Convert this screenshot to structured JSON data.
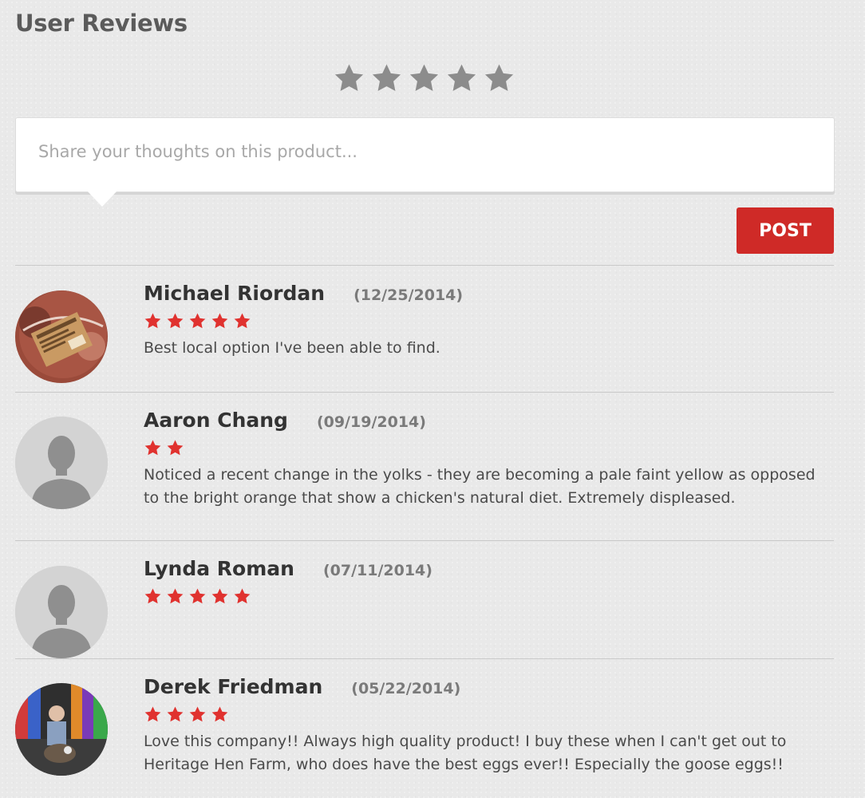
{
  "header": {
    "title": "User Reviews"
  },
  "rating_input": {
    "stars": 5,
    "selected": 0,
    "empty_color": "#8c8c8c"
  },
  "composer": {
    "placeholder": "Share your thoughts on this product..."
  },
  "post_button": {
    "label": "POST"
  },
  "colors": {
    "accent": "#cf2a27",
    "star_filled": "#e0322f"
  },
  "reviews": [
    {
      "name": "Michael Riordan",
      "date": "(12/25/2014)",
      "rating": 5,
      "text": "Best local option I've been able to find.",
      "avatar": "photo-product"
    },
    {
      "name": "Aaron Chang",
      "date": "(09/19/2014)",
      "rating": 2,
      "text": "Noticed a recent change in the yolks - they are becoming a pale faint yellow as opposed to the bright orange that show a chicken's natural diet. Extremely displeased.",
      "avatar": "default-user"
    },
    {
      "name": "Lynda Roman",
      "date": "(07/11/2014)",
      "rating": 5,
      "text": "",
      "avatar": "default-user"
    },
    {
      "name": "Derek Friedman",
      "date": "(05/22/2014)",
      "rating": 4,
      "text": "Love this company!! Always high quality product! I buy these when I can't get out to Heritage Hen Farm, who does have the best eggs ever!! Especially the goose eggs!!",
      "avatar": "photo-person"
    }
  ]
}
